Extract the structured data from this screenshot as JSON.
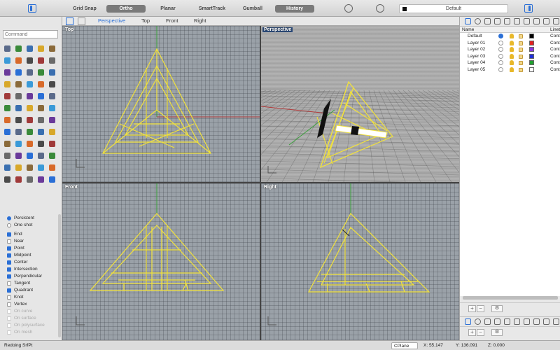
{
  "toolbar": {
    "snaps": [
      {
        "label": "Grid Snap",
        "on": false
      },
      {
        "label": "Ortho",
        "on": true
      },
      {
        "label": "Planar",
        "on": false
      },
      {
        "label": "SmartTrack",
        "on": false
      },
      {
        "label": "Gumball",
        "on": false
      },
      {
        "label": "History",
        "on": true
      }
    ],
    "current_layer": "Default"
  },
  "command": {
    "placeholder": "Command"
  },
  "tool_colors": [
    "#5a6a8a",
    "#4a4a4a",
    "#3a6fb0",
    "#6a6a6a",
    "#8a6a3a",
    "#2a6fd6",
    "#d86a2a",
    "#3a8a3a",
    "#a03a3a",
    "#d8a82a",
    "#6a3a9a",
    "#3a9ad8"
  ],
  "osnap": {
    "modes": [
      {
        "label": "Persistent",
        "on": true
      },
      {
        "label": "One shot",
        "on": false
      }
    ],
    "items": [
      {
        "label": "End",
        "checked": true,
        "enabled": true
      },
      {
        "label": "Near",
        "checked": false,
        "enabled": true
      },
      {
        "label": "Point",
        "checked": true,
        "enabled": true
      },
      {
        "label": "Midpoint",
        "checked": true,
        "enabled": true
      },
      {
        "label": "Center",
        "checked": true,
        "enabled": true
      },
      {
        "label": "Intersection",
        "checked": true,
        "enabled": true
      },
      {
        "label": "Perpendicular",
        "checked": true,
        "enabled": true
      },
      {
        "label": "Tangent",
        "checked": false,
        "enabled": true
      },
      {
        "label": "Quadrant",
        "checked": true,
        "enabled": true
      },
      {
        "label": "Knot",
        "checked": false,
        "enabled": true
      },
      {
        "label": "Vertex",
        "checked": false,
        "enabled": true
      },
      {
        "label": "On curve",
        "checked": false,
        "enabled": false
      },
      {
        "label": "On surface",
        "checked": false,
        "enabled": false
      },
      {
        "label": "On polysurface",
        "checked": false,
        "enabled": false
      },
      {
        "label": "On mesh",
        "checked": false,
        "enabled": false
      }
    ]
  },
  "viewport_tabs": [
    "Perspective",
    "Top",
    "Front",
    "Right"
  ],
  "active_tab": "Perspective",
  "viewports": {
    "top": "Top",
    "perspective": "Perspective",
    "front": "Front",
    "right": "Right"
  },
  "layers": {
    "header_name": "Name",
    "header_type": "Linety",
    "rows": [
      {
        "name": "Default",
        "current": true,
        "color": "#000000",
        "linetype": "Conti"
      },
      {
        "name": "Layer 01",
        "current": false,
        "color": "#e02020",
        "linetype": "Conti"
      },
      {
        "name": "Layer 02",
        "current": false,
        "color": "#8a3ae0",
        "linetype": "Conti"
      },
      {
        "name": "Layer 03",
        "current": false,
        "color": "#2030d8",
        "linetype": "Conti"
      },
      {
        "name": "Layer 04",
        "current": false,
        "color": "#20a030",
        "linetype": "Conti"
      },
      {
        "name": "Layer 05",
        "current": false,
        "color": "#ffffff",
        "linetype": "Conti"
      }
    ]
  },
  "colors": {
    "wire": "#f2e23a",
    "x_axis": "#b03a3a",
    "y_axis": "#3aa03a",
    "accent": "#2a6fd6"
  },
  "status": {
    "message": "Redoing SrfPt",
    "cplane": "CPlane",
    "x": "X: 55.147",
    "y": "Y: 136.091",
    "z": "Z: 0.000"
  }
}
